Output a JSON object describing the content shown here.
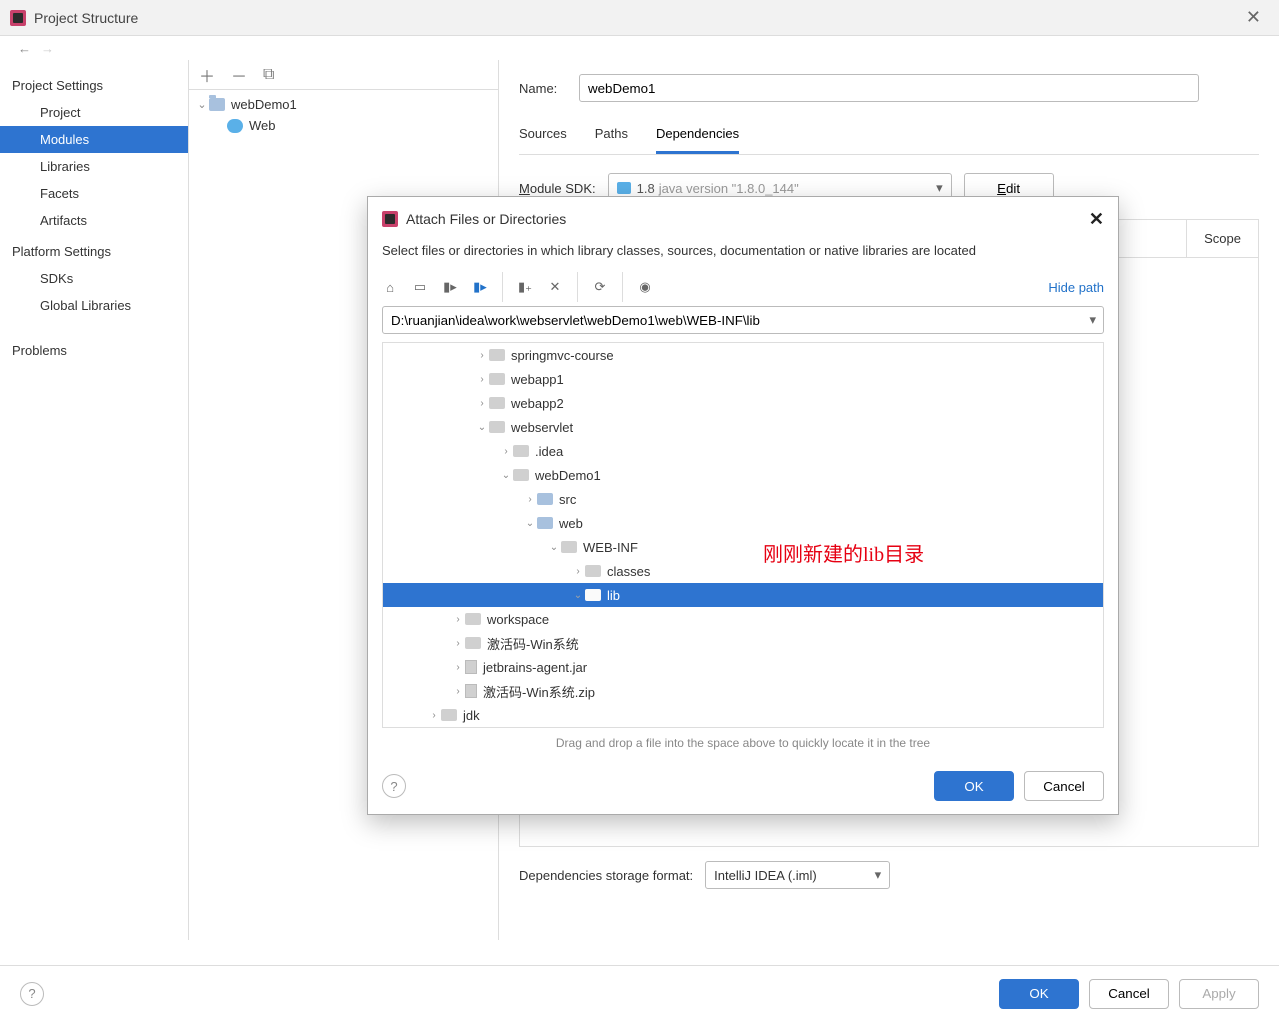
{
  "window": {
    "title": "Project Structure"
  },
  "sidebar": {
    "sections": [
      {
        "title": "Project Settings",
        "items": [
          "Project",
          "Modules",
          "Libraries",
          "Facets",
          "Artifacts"
        ],
        "selected": 1
      },
      {
        "title": "Platform Settings",
        "items": [
          "SDKs",
          "Global Libraries"
        ]
      },
      {
        "title": "",
        "items": [
          "Problems"
        ]
      }
    ]
  },
  "moduleTree": {
    "root": "webDemo1",
    "children": [
      "Web"
    ]
  },
  "detail": {
    "nameLabel": "Name:",
    "nameValue": "webDemo1",
    "tabs": [
      "Sources",
      "Paths",
      "Dependencies"
    ],
    "activeTab": 2,
    "moduleSdkLabel": "Module SDK:",
    "sdkName": "1.8",
    "sdkVersion": "java version \"1.8.0_144\"",
    "editLabel": "Edit",
    "scopeLabel": "Scope",
    "storageLabel": "Dependencies storage format:",
    "storageValue": "IntelliJ IDEA (.iml)"
  },
  "footer": {
    "ok": "OK",
    "cancel": "Cancel",
    "apply": "Apply"
  },
  "modal": {
    "title": "Attach Files or Directories",
    "description": "Select files or directories in which library classes, sources, documentation or native libraries are located",
    "hidePath": "Hide path",
    "path": "D:\\ruanjian\\idea\\work\\webservlet\\webDemo1\\web\\WEB-INF\\lib",
    "tree": [
      {
        "indent": "ind1",
        "arrow": "›",
        "icon": "f",
        "label": "springmvc-course"
      },
      {
        "indent": "ind1",
        "arrow": "›",
        "icon": "f",
        "label": "webapp1"
      },
      {
        "indent": "ind1",
        "arrow": "›",
        "icon": "f",
        "label": "webapp2"
      },
      {
        "indent": "ind1",
        "arrow": "⌄",
        "icon": "f",
        "label": "webservlet"
      },
      {
        "indent": "ind2",
        "arrow": "›",
        "icon": "f",
        "label": ".idea"
      },
      {
        "indent": "ind2",
        "arrow": "⌄",
        "icon": "f",
        "label": "webDemo1"
      },
      {
        "indent": "ind3",
        "arrow": "›",
        "icon": "fb",
        "label": "src"
      },
      {
        "indent": "ind3",
        "arrow": "⌄",
        "icon": "fb",
        "label": "web"
      },
      {
        "indent": "ind4",
        "arrow": "⌄",
        "icon": "f",
        "label": "WEB-INF"
      },
      {
        "indent": "ind5",
        "arrow": "›",
        "icon": "f",
        "label": "classes"
      },
      {
        "indent": "ind5",
        "arrow": "⌄",
        "icon": "f",
        "label": "lib",
        "selected": true
      },
      {
        "indent": "ind0b",
        "arrow": "›",
        "icon": "f",
        "label": "workspace"
      },
      {
        "indent": "ind0b",
        "arrow": "›",
        "icon": "f",
        "label": "激活码-Win系统"
      },
      {
        "indent": "ind0b",
        "arrow": "›",
        "icon": "j",
        "label": "jetbrains-agent.jar"
      },
      {
        "indent": "ind0b",
        "arrow": "›",
        "icon": "j",
        "label": "激活码-Win系统.zip"
      },
      {
        "indent": "ind0",
        "arrow": "›",
        "icon": "f",
        "label": "jdk"
      }
    ],
    "annotation": "刚刚新建的lib目录",
    "hint": "Drag and drop a file into the space above to quickly locate it in the tree",
    "ok": "OK",
    "cancel": "Cancel"
  }
}
